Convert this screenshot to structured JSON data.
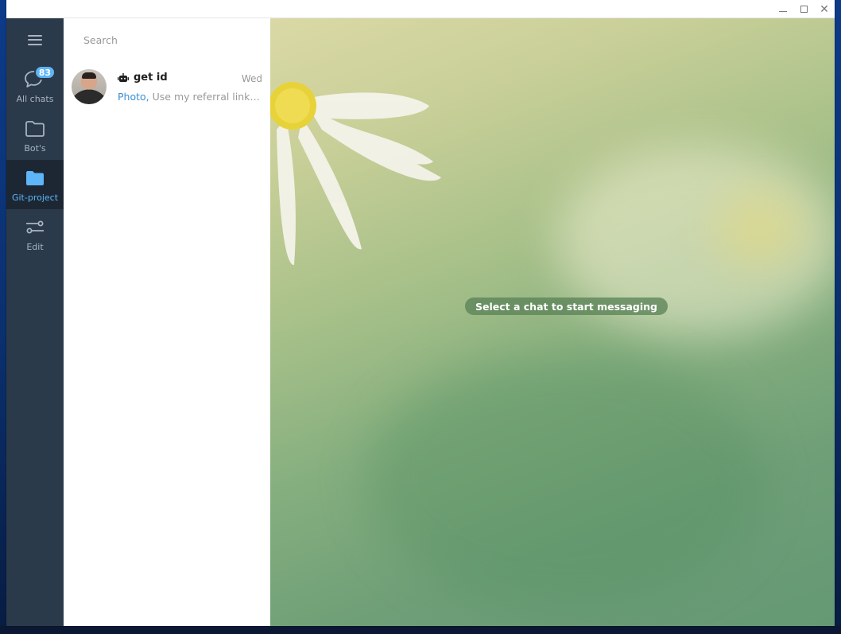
{
  "window": {
    "controls": {
      "minimize_icon": "minimize-icon",
      "maximize_icon": "maximize-icon",
      "close_icon": "close-icon"
    }
  },
  "folders": {
    "menu_icon": "hamburger-icon",
    "items": [
      {
        "label": "All chats",
        "icon": "chat-bubbles-icon",
        "badge": "83",
        "active": false
      },
      {
        "label": "Bot's",
        "icon": "folder-outline-icon",
        "active": false
      },
      {
        "label": "Git-project",
        "icon": "folder-filled-icon",
        "active": true
      },
      {
        "label": "Edit",
        "icon": "sliders-icon",
        "active": false
      }
    ],
    "colors": {
      "sidebar_bg": "#2b3a4b",
      "active_bg": "#1c2733",
      "accent": "#5eb5f7"
    }
  },
  "chatlist": {
    "search": {
      "placeholder": "Search",
      "value": ""
    },
    "chats": [
      {
        "title": "get id",
        "type_icon": "bot-icon",
        "date": "Wed",
        "preview_media": "Photo,",
        "preview_text": " Use my referral link to..."
      }
    ]
  },
  "pane": {
    "hint": "Select a chat to start messaging"
  }
}
